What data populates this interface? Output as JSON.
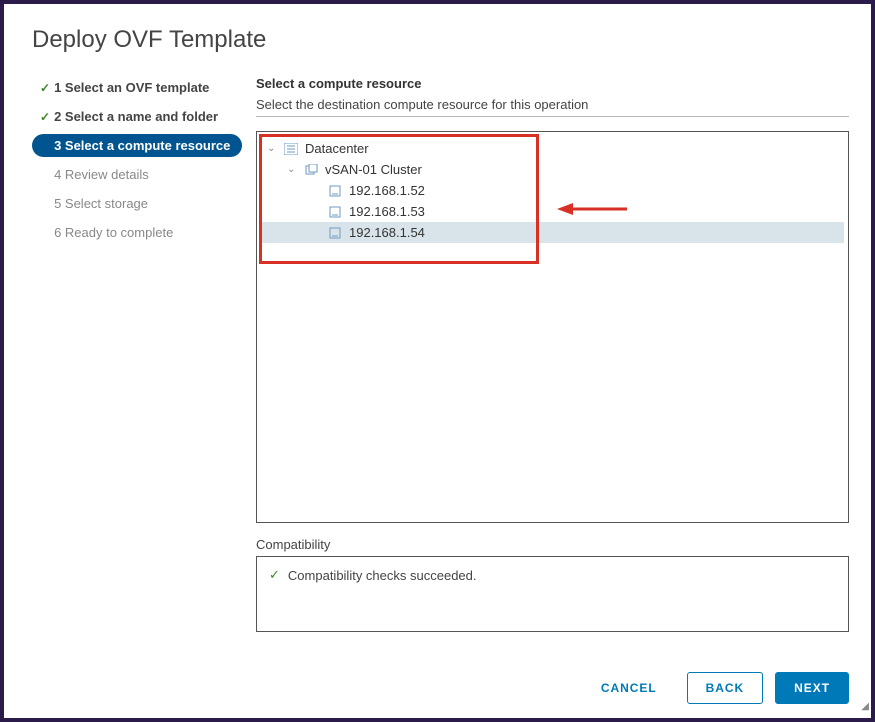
{
  "title": "Deploy OVF Template",
  "steps": [
    {
      "num": "1",
      "label": "Select an OVF template",
      "state": "completed"
    },
    {
      "num": "2",
      "label": "Select a name and folder",
      "state": "completed"
    },
    {
      "num": "3",
      "label": "Select a compute resource",
      "state": "active"
    },
    {
      "num": "4",
      "label": "Review details",
      "state": "inactive"
    },
    {
      "num": "5",
      "label": "Select storage",
      "state": "inactive"
    },
    {
      "num": "6",
      "label": "Ready to complete",
      "state": "inactive"
    }
  ],
  "main": {
    "heading": "Select a compute resource",
    "description": "Select the destination compute resource for this operation",
    "tree": {
      "datacenter": "Datacenter",
      "cluster": "vSAN-01 Cluster",
      "hosts": [
        "192.168.1.52",
        "192.168.1.53",
        "192.168.1.54"
      ],
      "selectedIndex": 2
    },
    "compat": {
      "label": "Compatibility",
      "message": "Compatibility checks succeeded."
    }
  },
  "buttons": {
    "cancel": "CANCEL",
    "back": "BACK",
    "next": "NEXT"
  }
}
